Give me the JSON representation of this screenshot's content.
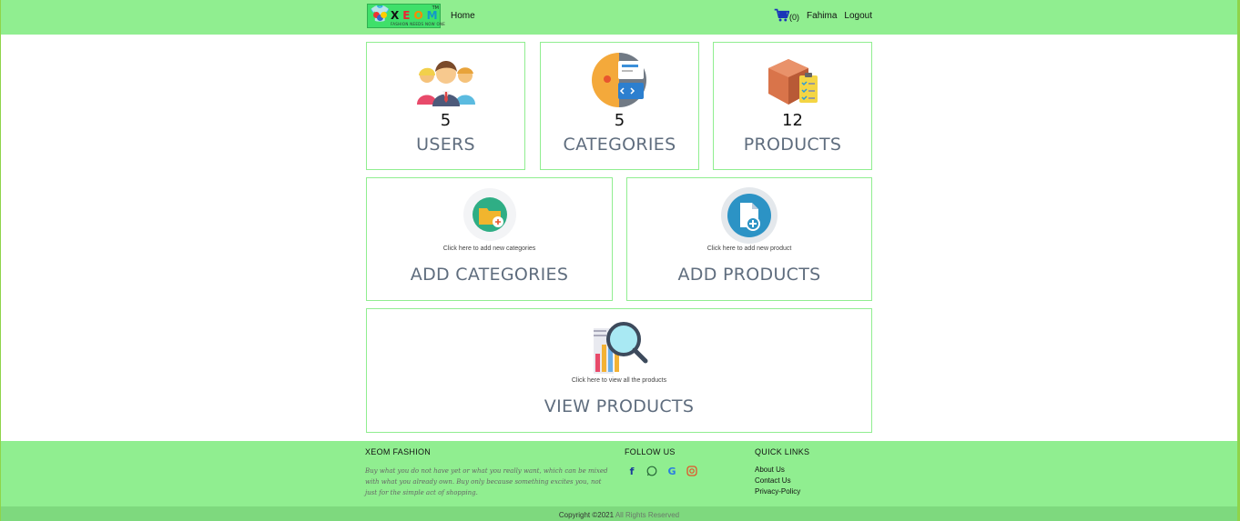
{
  "nav": {
    "logo_word": [
      "X",
      "E",
      "O",
      "M"
    ],
    "logo_tagline": "FASHION NEEDS NOW ONE",
    "logo_tm": "TM",
    "home": "Home",
    "cart_count": "(0)",
    "user": "Fahima",
    "logout": "Logout"
  },
  "stats": [
    {
      "count": "5",
      "label": "USERS"
    },
    {
      "count": "5",
      "label": "CATEGORIES"
    },
    {
      "count": "12",
      "label": "PRODUCTS"
    }
  ],
  "actions": {
    "add_categories": {
      "hint": "Click here to add new categories",
      "label": "ADD CATEGORIES"
    },
    "add_products": {
      "hint": "Click here to add new product",
      "label": "ADD PRODUCTS"
    },
    "view_products": {
      "hint": "Click here to view all the products",
      "label": "VIEW PRODUCTS"
    }
  },
  "footer": {
    "brand_title": "XEOM FASHION",
    "brand_text": "Buy what you do not have yet or what you really want, which can be mixed with what you already own. Buy only because something excites you, not just for the simple act of shopping.",
    "follow_title": "FOLLOW US",
    "social": [
      "facebook",
      "whatsapp",
      "google",
      "instagram"
    ],
    "links_title": "QUICK LINKS",
    "links": [
      "About Us",
      "Contact Us",
      "Privacy-Policy"
    ],
    "copyright": "Copyright ©2021",
    "rights": "All Rights Reserved"
  },
  "colors": {
    "bar_green": "#90ee90",
    "label_gray": "#5f6d7e"
  }
}
